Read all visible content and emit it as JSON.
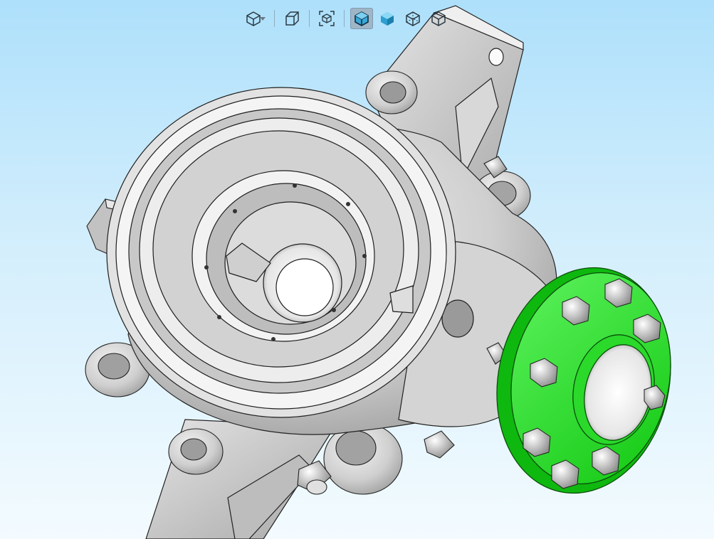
{
  "viewport": {
    "background_top": "#aee0fb",
    "background_bottom": "#f3fbff",
    "selected_face_color": "#2fe12f",
    "part_color": "#c9c9c9"
  },
  "toolbar": {
    "buttons": [
      {
        "name": "view-orientation-icon",
        "has_dropdown": true,
        "active": false
      },
      {
        "name": "previous-view-icon",
        "has_dropdown": false,
        "active": false
      },
      {
        "name": "zoom-to-fit-icon",
        "has_dropdown": false,
        "active": false
      },
      {
        "name": "shaded-with-edges-icon",
        "has_dropdown": false,
        "active": true
      },
      {
        "name": "shaded-icon",
        "has_dropdown": false,
        "active": false
      },
      {
        "name": "hidden-lines-visible-icon",
        "has_dropdown": false,
        "active": false
      },
      {
        "name": "hidden-lines-removed-icon",
        "has_dropdown": false,
        "active": false
      }
    ]
  }
}
